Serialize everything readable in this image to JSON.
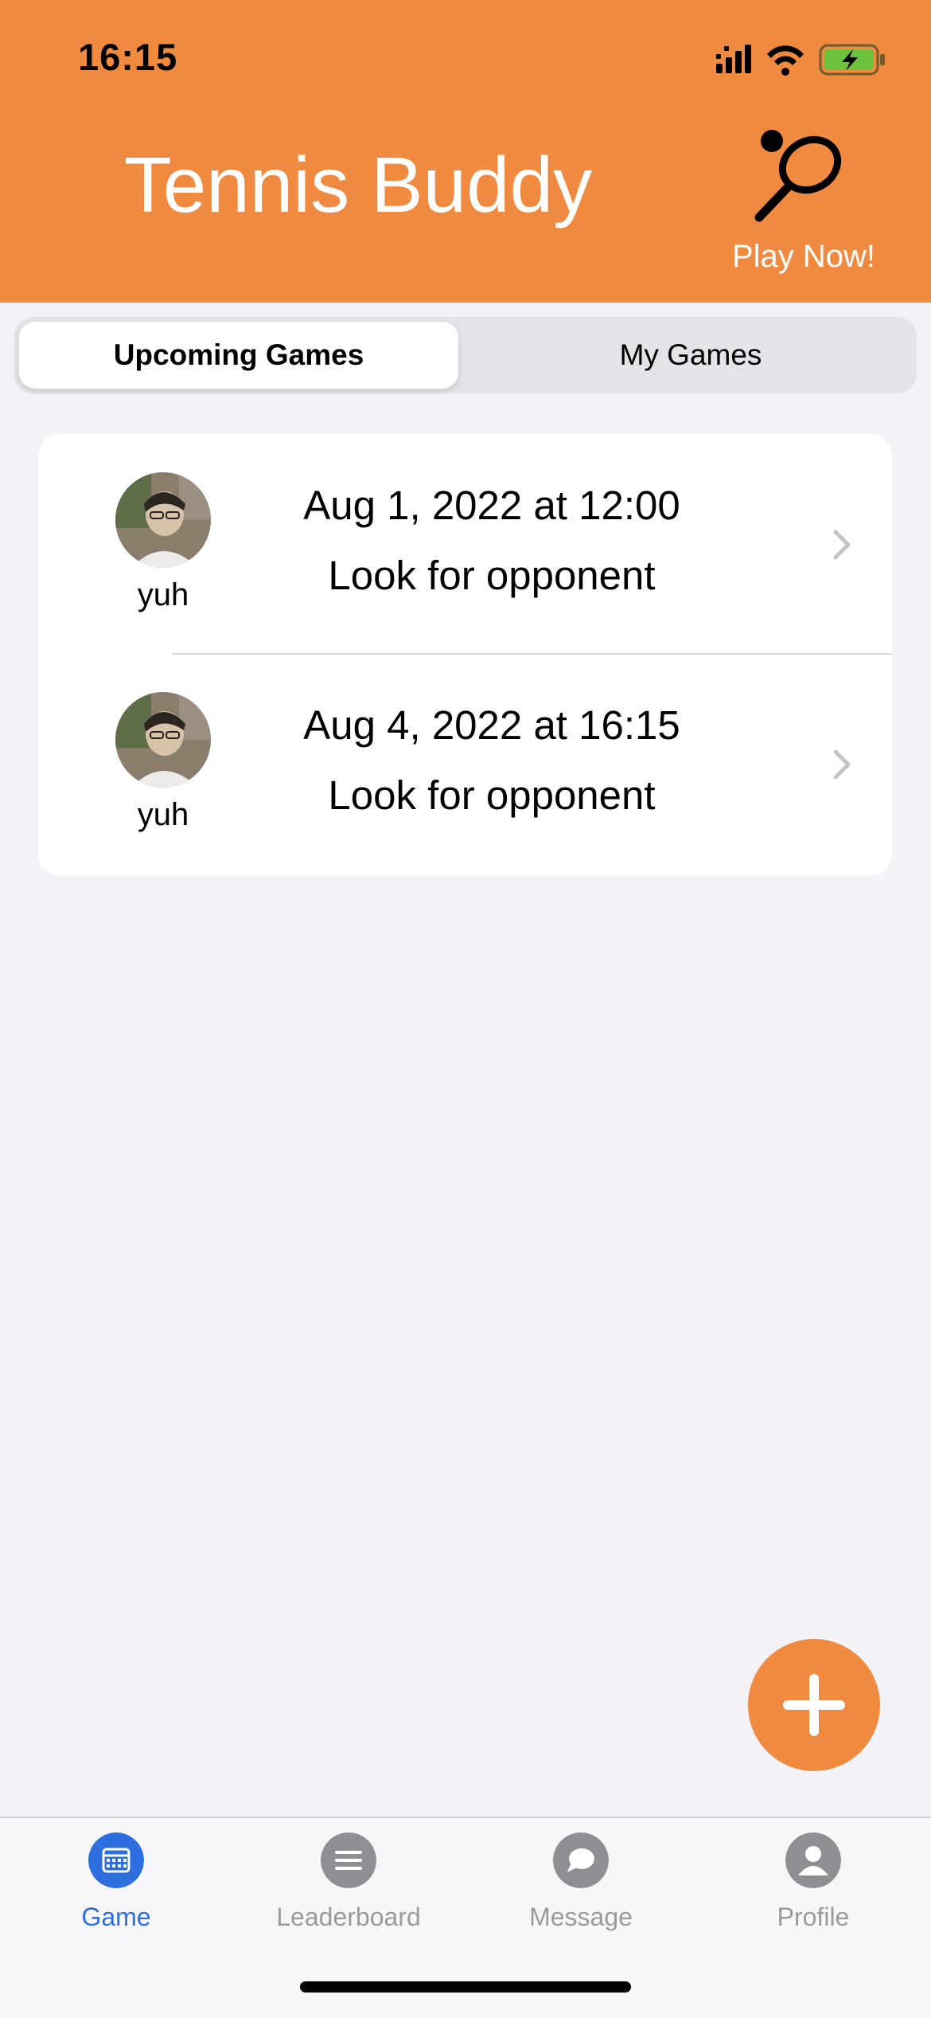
{
  "status_bar": {
    "time": "16:15"
  },
  "header": {
    "title": "Tennis Buddy",
    "play_now_label": "Play Now!",
    "brand_color": "#f08a41"
  },
  "segmented": {
    "items": [
      {
        "label": "Upcoming Games",
        "selected": true
      },
      {
        "label": "My Games",
        "selected": false
      }
    ]
  },
  "games": [
    {
      "username": "yuh",
      "date": "Aug 1, 2022 at 12:00",
      "status": "Look for opponent"
    },
    {
      "username": "yuh",
      "date": "Aug 4, 2022 at 16:15",
      "status": "Look for opponent"
    }
  ],
  "fab": {
    "icon": "plus-icon"
  },
  "tabbar": {
    "tabs": [
      {
        "label": "Game",
        "icon": "calendar-icon",
        "active": true
      },
      {
        "label": "Leaderboard",
        "icon": "list-icon",
        "active": false
      },
      {
        "label": "Message",
        "icon": "chat-bubble-icon",
        "active": false
      },
      {
        "label": "Profile",
        "icon": "person-icon",
        "active": false
      }
    ],
    "active_color": "#2d6fde",
    "inactive_color": "#9b9b9f"
  }
}
